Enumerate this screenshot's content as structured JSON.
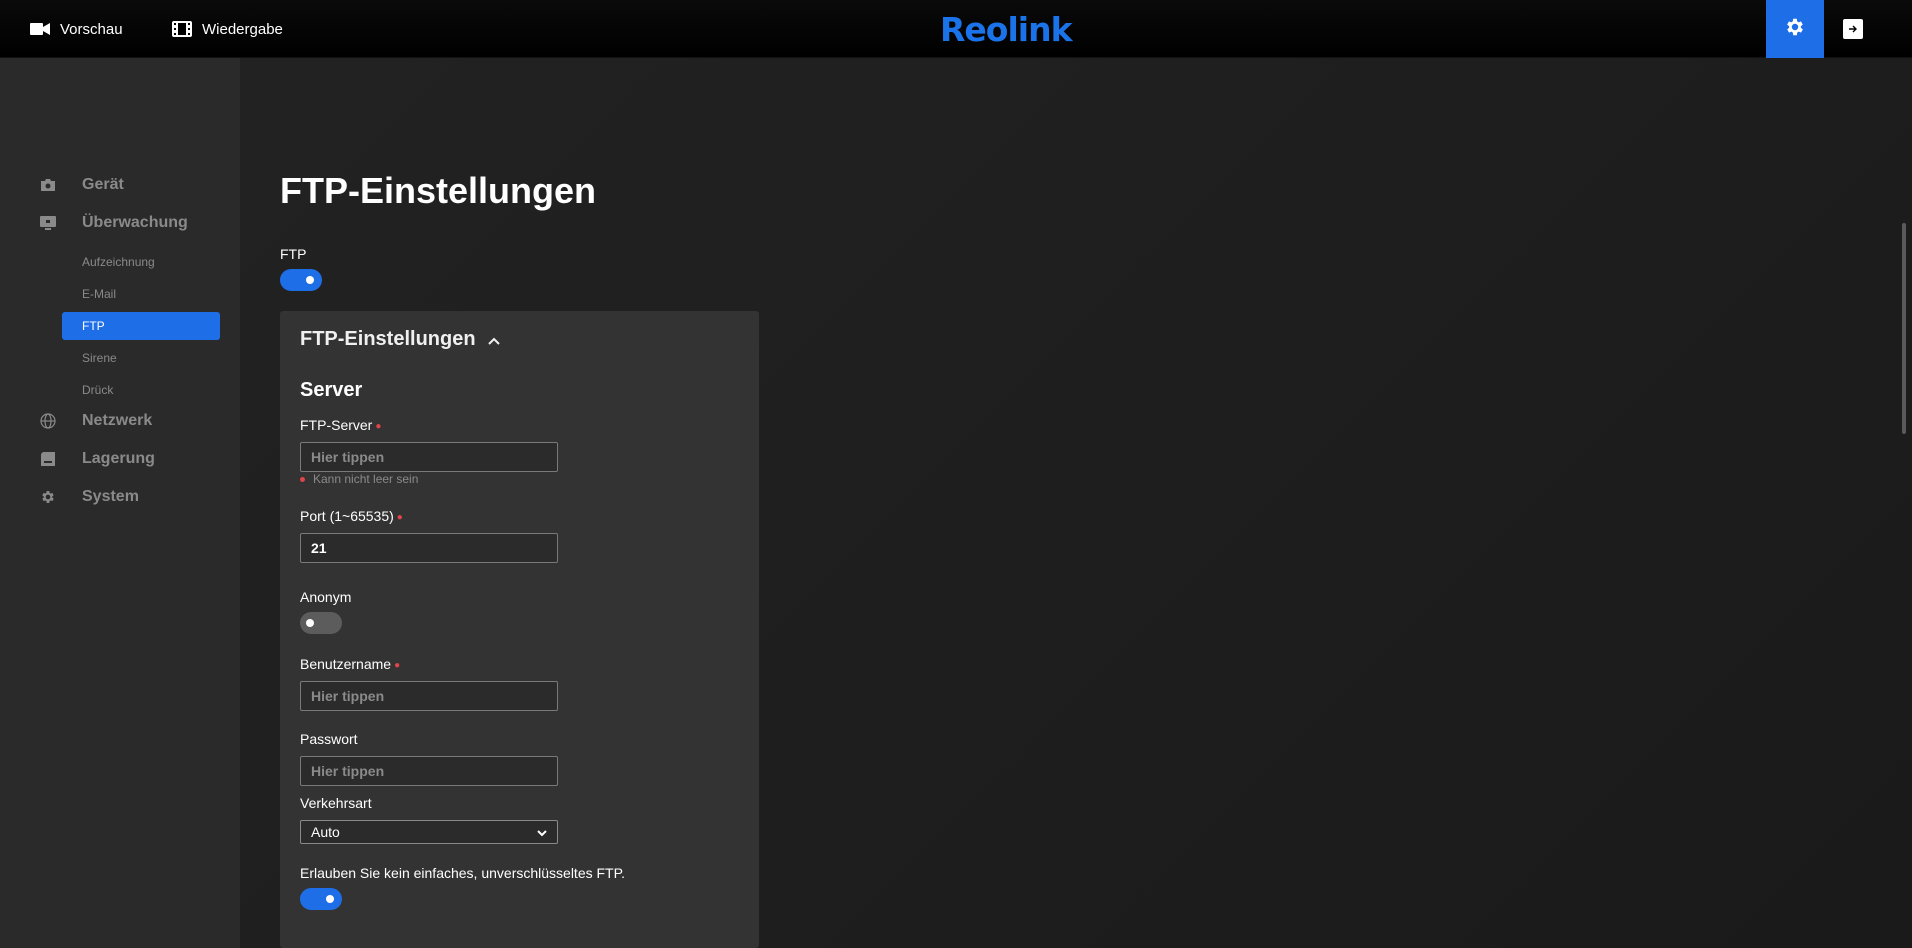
{
  "topbar": {
    "preview_label": "Vorschau",
    "playback_label": "Wiedergabe",
    "logo": "Reolink"
  },
  "sidebar": {
    "device": "Gerät",
    "monitoring": "Überwachung",
    "sub_items": [
      "Aufzeichnung",
      "E-Mail",
      "FTP",
      "Sirene",
      "Drück"
    ],
    "active_sub": "FTP",
    "network": "Netzwerk",
    "storage": "Lagerung",
    "system": "System"
  },
  "main": {
    "page_title": "FTP-Einstellungen",
    "ftp_toggle_label": "FTP",
    "ftp_enabled": true,
    "panel": {
      "title": "FTP-Einstellungen",
      "section": "Server",
      "ftp_server_label": "FTP-Server",
      "ftp_server_value": "",
      "ftp_server_placeholder": "Hier tippen",
      "ftp_server_error": "Kann nicht leer sein",
      "port_label": "Port (1~65535)",
      "port_value": "21",
      "anonymous_label": "Anonym",
      "anonymous_enabled": false,
      "username_label": "Benutzername",
      "username_placeholder": "Hier tippen",
      "password_label": "Passwort",
      "password_placeholder": "Hier tippen",
      "transfer_mode_label": "Verkehrsart",
      "transfer_mode_value": "Auto",
      "disallow_plain_label": "Erlauben Sie kein einfaches, unverschlüsseltes FTP.",
      "disallow_plain_enabled": true
    }
  },
  "colors": {
    "accent": "#1e6ee8",
    "required": "#e0454a"
  }
}
